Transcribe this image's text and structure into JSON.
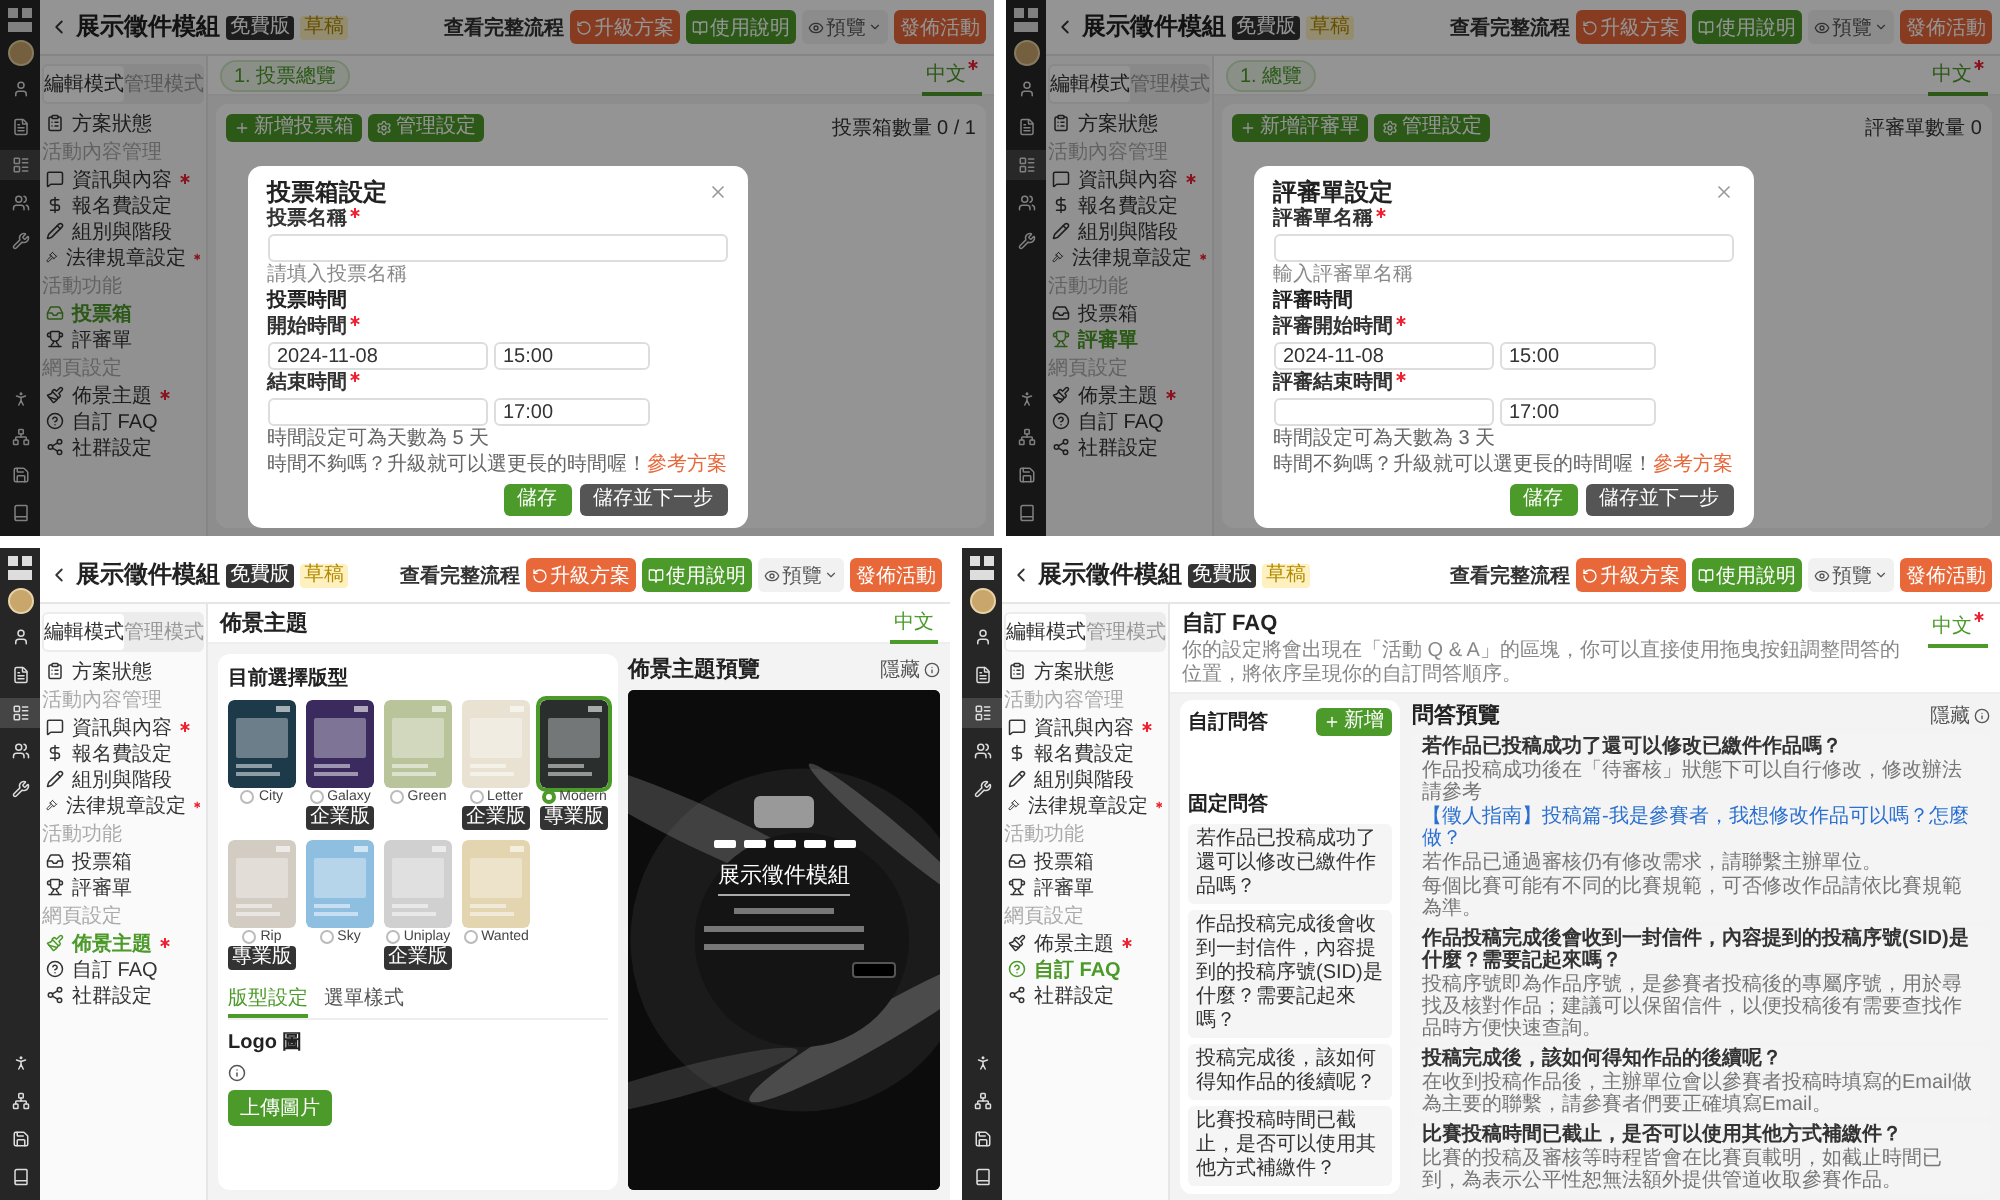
{
  "panels": [
    {
      "kind": "modal",
      "shell": {
        "rail": [
          {
            "selected": false
          },
          {
            "selected": false
          },
          {
            "selected": true
          },
          {
            "selected": false
          },
          {
            "selected": false
          },
          {
            "selected": false
          },
          {
            "selected": false
          },
          {
            "selected": false
          },
          {
            "selected": false
          }
        ],
        "title": "展示徵件模組",
        "badges": [
          {
            "label": "免費版",
            "kind": "plan"
          },
          {
            "label": "草稿",
            "kind": "status"
          }
        ],
        "flow_link": "查看完整流程",
        "actions": [
          {
            "label": "升級方案",
            "kind": "upgrade"
          },
          {
            "label": "使用說明",
            "kind": "guide"
          },
          {
            "label": "預覽",
            "kind": "dropdown"
          },
          {
            "label": "發佈活動",
            "kind": "publish"
          }
        ],
        "mode_tabs": [
          {
            "label": "編輯模式",
            "selected": true
          },
          {
            "label": "管理模式",
            "selected": false
          }
        ],
        "sidebar": [
          {
            "kind": "item",
            "label": "方案狀態",
            "required": false,
            "selected": false
          },
          {
            "kind": "heading",
            "label": "活動內容管理"
          },
          {
            "kind": "item",
            "label": "資訊與內容",
            "required": true,
            "selected": false
          },
          {
            "kind": "item",
            "label": "報名費設定",
            "required": false,
            "selected": false
          },
          {
            "kind": "item",
            "label": "組別與階段",
            "required": false,
            "selected": false
          },
          {
            "kind": "item",
            "label": "法律規章設定",
            "required": true,
            "selected": false
          },
          {
            "kind": "heading",
            "label": "活動功能"
          },
          {
            "kind": "item",
            "label": "投票箱",
            "required": false,
            "selected": true
          },
          {
            "kind": "item",
            "label": "評審單",
            "required": false,
            "selected": false
          },
          {
            "kind": "heading",
            "label": "網頁設定"
          },
          {
            "kind": "item",
            "label": "佈景主題",
            "required": true,
            "selected": false
          },
          {
            "kind": "item",
            "label": "自訂 FAQ",
            "required": false,
            "selected": false
          },
          {
            "kind": "item",
            "label": "社群設定",
            "required": false,
            "selected": false
          }
        ]
      },
      "language": {
        "label": "中文",
        "required": true
      },
      "step": "1. 投票總覽",
      "toolbar": [
        {
          "label": "新增投票箱",
          "kind": "add"
        },
        {
          "label": "管理設定",
          "kind": "settings"
        }
      ],
      "count": "投票箱數量 0 / 1",
      "dialog": {
        "title": "投票箱設定",
        "name": {
          "label": "投票名稱",
          "required": true,
          "hint": "請填入投票名稱"
        },
        "section": "投票時間",
        "start": {
          "label": "開始時間",
          "required": true,
          "date": "2024-11-08",
          "time": "15:00"
        },
        "end": {
          "label": "結束時間",
          "required": true,
          "time": "17:00"
        },
        "notes": [
          "時間設定可為天數為 5 天",
          "時間不夠嗎？升級就可以選更長的時間喔！"
        ],
        "link": "參考方案",
        "buttons": [
          {
            "label": "儲存",
            "kind": "primary"
          },
          {
            "label": "儲存並下一步",
            "kind": "secondary"
          }
        ]
      }
    },
    {
      "kind": "modal",
      "shell": {
        "rail": [
          {
            "selected": false
          },
          {
            "selected": false
          },
          {
            "selected": true
          },
          {
            "selected": false
          },
          {
            "selected": false
          },
          {
            "selected": false
          },
          {
            "selected": false
          },
          {
            "selected": false
          },
          {
            "selected": false
          }
        ],
        "title": "展示徵件模組",
        "badges": [
          {
            "label": "免費版",
            "kind": "plan"
          },
          {
            "label": "草稿",
            "kind": "status"
          }
        ],
        "flow_link": "查看完整流程",
        "actions": [
          {
            "label": "升級方案",
            "kind": "upgrade"
          },
          {
            "label": "使用說明",
            "kind": "guide"
          },
          {
            "label": "預覽",
            "kind": "dropdown"
          },
          {
            "label": "發佈活動",
            "kind": "publish"
          }
        ],
        "mode_tabs": [
          {
            "label": "編輯模式",
            "selected": true
          },
          {
            "label": "管理模式",
            "selected": false
          }
        ],
        "sidebar": [
          {
            "kind": "item",
            "label": "方案狀態",
            "required": false,
            "selected": false
          },
          {
            "kind": "heading",
            "label": "活動內容管理"
          },
          {
            "kind": "item",
            "label": "資訊與內容",
            "required": true,
            "selected": false
          },
          {
            "kind": "item",
            "label": "報名費設定",
            "required": false,
            "selected": false
          },
          {
            "kind": "item",
            "label": "組別與階段",
            "required": false,
            "selected": false
          },
          {
            "kind": "item",
            "label": "法律規章設定",
            "required": true,
            "selected": false
          },
          {
            "kind": "heading",
            "label": "活動功能"
          },
          {
            "kind": "item",
            "label": "投票箱",
            "required": false,
            "selected": false
          },
          {
            "kind": "item",
            "label": "評審單",
            "required": false,
            "selected": true
          },
          {
            "kind": "heading",
            "label": "網頁設定"
          },
          {
            "kind": "item",
            "label": "佈景主題",
            "required": true,
            "selected": false
          },
          {
            "kind": "item",
            "label": "自訂 FAQ",
            "required": false,
            "selected": false
          },
          {
            "kind": "item",
            "label": "社群設定",
            "required": false,
            "selected": false
          }
        ]
      },
      "language": {
        "label": "中文",
        "required": true
      },
      "step": "1. 總覽",
      "toolbar": [
        {
          "label": "新增評審單",
          "kind": "add"
        },
        {
          "label": "管理設定",
          "kind": "settings"
        }
      ],
      "count": "評審單數量 0",
      "dialog": {
        "title": "評審單設定",
        "name": {
          "label": "評審單名稱",
          "required": true,
          "hint": "輸入評審單名稱"
        },
        "section": "評審時間",
        "start": {
          "label": "評審開始時間",
          "required": true,
          "date": "2024-11-08",
          "time": "15:00"
        },
        "end": {
          "label": "評審結束時間",
          "required": true,
          "time": "17:00"
        },
        "notes": [
          "時間設定可為天數為 3 天",
          "時間不夠嗎？升級就可以選更長的時間喔！"
        ],
        "link": "參考方案",
        "buttons": [
          {
            "label": "儲存",
            "kind": "primary"
          },
          {
            "label": "儲存並下一步",
            "kind": "secondary"
          }
        ]
      }
    },
    {
      "kind": "theme",
      "shell": {
        "rail": [
          {
            "selected": false
          },
          {
            "selected": false
          },
          {
            "selected": true
          },
          {
            "selected": false
          },
          {
            "selected": false
          },
          {
            "selected": false
          },
          {
            "selected": false
          },
          {
            "selected": false
          },
          {
            "selected": false
          }
        ],
        "title": "展示徵件模組",
        "badges": [
          {
            "label": "免費版",
            "kind": "plan"
          },
          {
            "label": "草稿",
            "kind": "status"
          }
        ],
        "flow_link": "查看完整流程",
        "actions": [
          {
            "label": "升級方案",
            "kind": "upgrade"
          },
          {
            "label": "使用說明",
            "kind": "guide"
          },
          {
            "label": "預覽",
            "kind": "dropdown"
          },
          {
            "label": "發佈活動",
            "kind": "publish"
          }
        ],
        "mode_tabs": [
          {
            "label": "編輯模式",
            "selected": true
          },
          {
            "label": "管理模式",
            "selected": false
          }
        ],
        "sidebar": [
          {
            "kind": "item",
            "label": "方案狀態",
            "required": false,
            "selected": false
          },
          {
            "kind": "heading",
            "label": "活動內容管理"
          },
          {
            "kind": "item",
            "label": "資訊與內容",
            "required": true,
            "selected": false
          },
          {
            "kind": "item",
            "label": "報名費設定",
            "required": false,
            "selected": false
          },
          {
            "kind": "item",
            "label": "組別與階段",
            "required": false,
            "selected": false
          },
          {
            "kind": "item",
            "label": "法律規章設定",
            "required": true,
            "selected": false
          },
          {
            "kind": "heading",
            "label": "活動功能"
          },
          {
            "kind": "item",
            "label": "投票箱",
            "required": false,
            "selected": false
          },
          {
            "kind": "item",
            "label": "評審單",
            "required": false,
            "selected": false
          },
          {
            "kind": "heading",
            "label": "網頁設定"
          },
          {
            "kind": "item",
            "label": "佈景主題",
            "required": true,
            "selected": true
          },
          {
            "kind": "item",
            "label": "自訂 FAQ",
            "required": false,
            "selected": false
          },
          {
            "kind": "item",
            "label": "社群設定",
            "required": false,
            "selected": false
          }
        ]
      },
      "language": {
        "label": "中文",
        "required": false
      },
      "page_title": "佈景主題",
      "theme_card": {
        "title": "目前選擇版型",
        "themes": [
          {
            "name": "City",
            "selected": false,
            "color": "#1d3a4a"
          },
          {
            "name": "Galaxy",
            "selected": false,
            "color": "#3a2a5e",
            "badge": "企業版"
          },
          {
            "name": "Green",
            "selected": false,
            "color": "#b9c49a"
          },
          {
            "name": "Letter",
            "selected": false,
            "color": "#e9e2d2",
            "badge": "企業版"
          },
          {
            "name": "Modern",
            "selected": true,
            "color": "#2a2f2e",
            "badge": "專業版"
          },
          {
            "name": "Rip",
            "selected": false,
            "color": "#d3ccc2",
            "badge": "專業版"
          },
          {
            "name": "Sky",
            "selected": false,
            "color": "#8fbfe0"
          },
          {
            "name": "Uniplay",
            "selected": false,
            "color": "#d0d0d0",
            "badge": "企業版"
          },
          {
            "name": "Wanted",
            "selected": false,
            "color": "#e3d5b0"
          }
        ],
        "tabs": [
          {
            "label": "版型設定",
            "selected": true
          },
          {
            "label": "選單樣式",
            "selected": false
          }
        ],
        "logo_label": "Logo 圖",
        "upload": "上傳圖片"
      },
      "preview": {
        "title": "佈景主題預覽",
        "hide": "隱藏",
        "site_title": "展示徵件模組"
      }
    },
    {
      "kind": "faq",
      "shell": {
        "rail": [
          {
            "selected": false
          },
          {
            "selected": false
          },
          {
            "selected": true
          },
          {
            "selected": false
          },
          {
            "selected": false
          },
          {
            "selected": false
          },
          {
            "selected": false
          },
          {
            "selected": false
          },
          {
            "selected": false
          }
        ],
        "title": "展示徵件模組",
        "badges": [
          {
            "label": "免費版",
            "kind": "plan"
          },
          {
            "label": "草稿",
            "kind": "status"
          }
        ],
        "flow_link": "查看完整流程",
        "actions": [
          {
            "label": "升級方案",
            "kind": "upgrade"
          },
          {
            "label": "使用說明",
            "kind": "guide"
          },
          {
            "label": "預覽",
            "kind": "dropdown"
          },
          {
            "label": "發佈活動",
            "kind": "publish"
          }
        ],
        "mode_tabs": [
          {
            "label": "編輯模式",
            "selected": true
          },
          {
            "label": "管理模式",
            "selected": false
          }
        ],
        "sidebar": [
          {
            "kind": "item",
            "label": "方案狀態",
            "required": false,
            "selected": false
          },
          {
            "kind": "heading",
            "label": "活動內容管理"
          },
          {
            "kind": "item",
            "label": "資訊與內容",
            "required": true,
            "selected": false
          },
          {
            "kind": "item",
            "label": "報名費設定",
            "required": false,
            "selected": false
          },
          {
            "kind": "item",
            "label": "組別與階段",
            "required": false,
            "selected": false
          },
          {
            "kind": "item",
            "label": "法律規章設定",
            "required": true,
            "selected": false
          },
          {
            "kind": "heading",
            "label": "活動功能"
          },
          {
            "kind": "item",
            "label": "投票箱",
            "required": false,
            "selected": false
          },
          {
            "kind": "item",
            "label": "評審單",
            "required": false,
            "selected": false
          },
          {
            "kind": "heading",
            "label": "網頁設定"
          },
          {
            "kind": "item",
            "label": "佈景主題",
            "required": true,
            "selected": false
          },
          {
            "kind": "item",
            "label": "自訂 FAQ",
            "required": false,
            "selected": true
          },
          {
            "kind": "item",
            "label": "社群設定",
            "required": false,
            "selected": false
          }
        ]
      },
      "language": {
        "label": "中文",
        "required": true
      },
      "page_title": "自訂 FAQ",
      "subtitle": "你的設定將會出現在「活動 Q & A」的區塊，你可以直接使用拖曳按鈕調整問答的位置，將依序呈現你的自訂問答順序。",
      "custom": {
        "title": "自訂問答",
        "add": "新增"
      },
      "fixed": {
        "title": "固定問答",
        "items": [
          "若作品已投稿成功了還可以修改已繳件作品嗎？",
          "作品投稿完成後會收到一封信件，內容提到的投稿序號(SID)是什麼？需要記起來嗎？",
          "投稿完成後，該如何得知作品的後續呢？",
          "比賽投稿時間已截止，是否可以使用其他方式補繳件？"
        ]
      },
      "preview": {
        "title": "問答預覽",
        "hide": "隱藏",
        "items": [
          {
            "question": "若作品已投稿成功了還可以修改已繳件作品嗎？",
            "answers": [
              {
                "kind": "text",
                "text": "作品投稿成功後在「待審核」狀態下可以自行修改，修改辦法請參考"
              },
              {
                "kind": "link",
                "text": "【徵人指南】投稿篇-我是參賽者，我想修改作品可以嗎？怎麼做？"
              },
              {
                "kind": "text",
                "text": "若作品已通過審核仍有修改需求，請聯繫主辦單位。"
              },
              {
                "kind": "text",
                "text": "每個比賽可能有不同的比賽規範，可否修改作品請依比賽規範為準。"
              }
            ]
          },
          {
            "question": "作品投稿完成後會收到一封信件，內容提到的投稿序號(SID)是什麼？需要記起來嗎？",
            "answers": [
              {
                "kind": "text",
                "text": "投稿序號即為作品序號，是參賽者投稿後的專屬序號，用於尋找及核對作品；建議可以保留信件，以便投稿後有需要查找作品時方便快速查詢。"
              }
            ]
          },
          {
            "question": "投稿完成後，該如何得知作品的後續呢？",
            "answers": [
              {
                "kind": "text",
                "text": "在收到投稿作品後，主辦單位會以參賽者投稿時填寫的Email做為主要的聯繫，請參賽者們要正確填寫Email。"
              }
            ]
          },
          {
            "question": "比賽投稿時間已截止，是否可以使用其他方式補繳件？",
            "answers": [
              {
                "kind": "text",
                "text": "比賽的投稿及審核等時程皆會在比賽頁載明，如截止時間已到，為表示公平性恕無法額外提供管道收取參賽作品。"
              }
            ]
          }
        ]
      }
    }
  ]
}
